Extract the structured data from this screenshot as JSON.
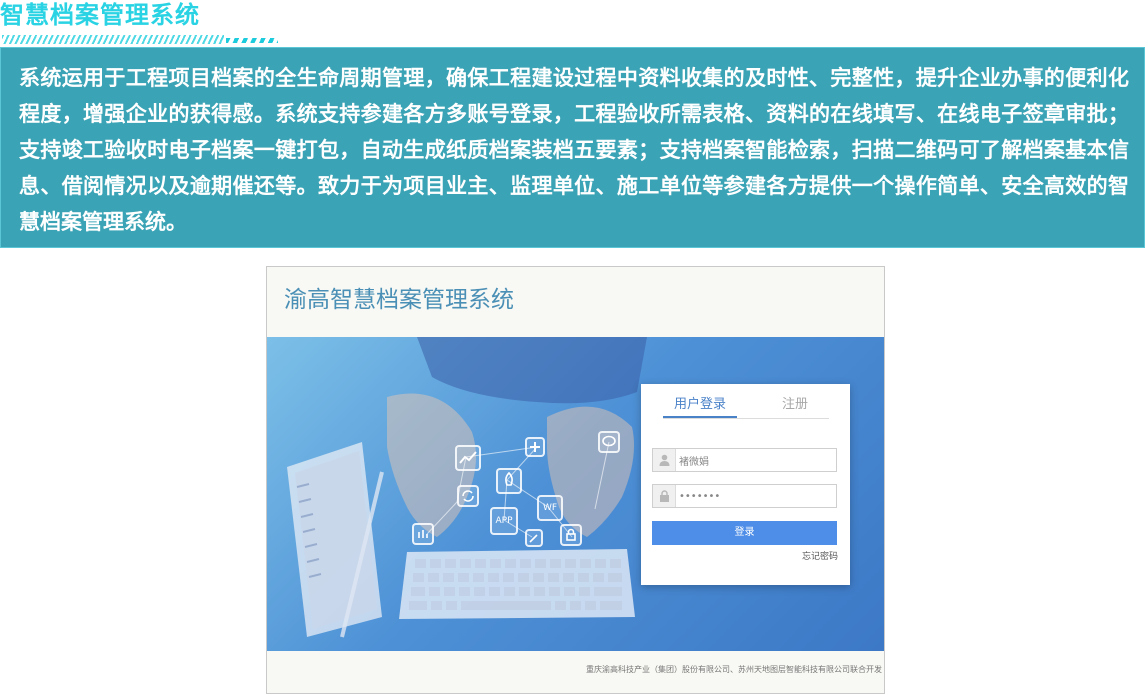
{
  "header": {
    "title": "智慧档案管理系统"
  },
  "description": {
    "text": "系统运用于工程项目档案的全生命周期管理，确保工程建设过程中资料收集的及时性、完整性，提升企业办事的便利化程度，增强企业的获得感。系统支持参建各方多账号登录，工程验收所需表格、资料的在线填写、在线电子签章审批；支持竣工验收时电子档案一键打包，自动生成纸质档案装档五要素；支持档案智能检索，扫描二维码可了解档案基本信息、借阅情况以及逾期催还等。致力于为项目业主、监理单位、施工单位等参建各方提供一个操作简单、安全高效的智慧档案管理系统。"
  },
  "screenshot": {
    "app_title": "渝高智慧档案管理系统",
    "hero_badges": [
      "APP",
      "WF"
    ],
    "login": {
      "tabs": [
        {
          "label": "用户登录",
          "active": true
        },
        {
          "label": "注册",
          "active": false
        }
      ],
      "username": {
        "value": "褚微娟",
        "icon": "user-icon"
      },
      "password": {
        "value": "•••••••",
        "icon": "lock-icon"
      },
      "submit_label": "登录",
      "forgot_label": "忘记密码"
    },
    "footer": "重庆渝高科技产业（集团）股份有限公司、苏州天地图层智能科技有限公司联合开发"
  },
  "colors": {
    "title": "#29d3e3",
    "panel_bg": "#3aa3b5",
    "app_title": "#4a8fb5",
    "active_tab": "#4a82c8",
    "login_button": "#4e8ee8"
  }
}
